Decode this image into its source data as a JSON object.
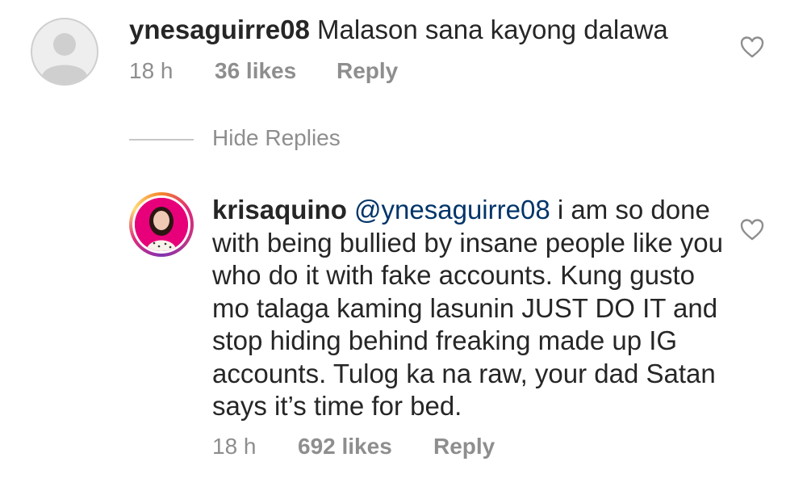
{
  "comment": {
    "username": "ynesaguirre08",
    "text": "Malason sana kayong dalawa",
    "time": "18 h",
    "likes": "36 likes",
    "reply_label": "Reply",
    "like_icon": "heart-outline-icon",
    "avatar_icon": "default-avatar-icon"
  },
  "replies_toggle": {
    "label": "Hide Replies"
  },
  "reply": {
    "username": "krisaquino",
    "mention": "@ynesaguirre08",
    "text": " i am so done with being bullied by insane people like you who do it with fake accounts. Kung gusto mo talaga kaming lasunin JUST DO IT and stop hiding behind freaking made up IG accounts. Tulog ka na raw, your dad Satan says it’s time for bed.",
    "time": "18 h",
    "likes": "692 likes",
    "reply_label": "Reply",
    "like_icon": "heart-outline-icon",
    "colors": {
      "story_ring": "#dd2a7b",
      "mention": "#003569"
    }
  }
}
